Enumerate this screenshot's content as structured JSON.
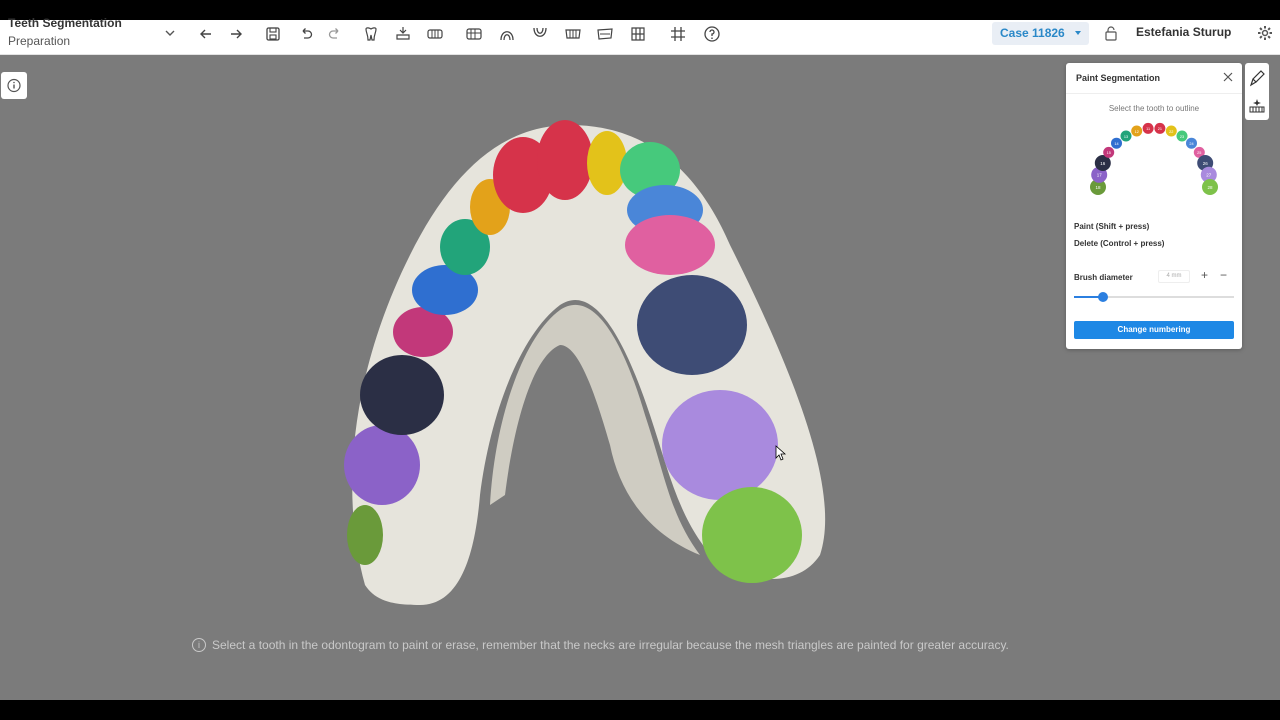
{
  "toolbar": {
    "title": "Teeth Segmentation",
    "subtitle": "Preparation",
    "icons": [
      "back-arrow-icon",
      "forward-arrow-icon",
      "save-icon",
      "undo-icon",
      "redo-icon",
      "tooth-tool-icon",
      "tooth-import-icon",
      "scan-icon",
      "jaw-icon",
      "arch-upper-icon",
      "arch-lower-icon",
      "bite-icon",
      "occlusion-icon",
      "model-icon",
      "grid-icon",
      "help-icon"
    ],
    "case_label": "Case 11826",
    "user_name": "Estefania Sturup"
  },
  "viewport": {
    "hint_text": "Select a tooth in the odontogram to paint or erase, remember that the necks are irregular because the mesh triangles are painted for greater accuracy."
  },
  "panel": {
    "title": "Paint Segmentation",
    "odontogram_label": "Select the tooth to outline",
    "paint_hint": "Paint (Shift + press)",
    "delete_hint": "Delete (Control + press)",
    "brush_label": "Brush diameter",
    "brush_value": "4 mm",
    "brush_fraction": 0.18,
    "change_button": "Change numbering",
    "teeth": [
      {
        "num": "18",
        "color": "#6a9a3a"
      },
      {
        "num": "17",
        "color": "#8b62c8"
      },
      {
        "num": "16",
        "color": "#2b2f45"
      },
      {
        "num": "15",
        "color": "#c2387a"
      },
      {
        "num": "14",
        "color": "#2f6fd0"
      },
      {
        "num": "13",
        "color": "#22a47a"
      },
      {
        "num": "12",
        "color": "#e3a21a"
      },
      {
        "num": "11",
        "color": "#d6334a"
      },
      {
        "num": "21",
        "color": "#d6334a"
      },
      {
        "num": "22",
        "color": "#e3c21a"
      },
      {
        "num": "23",
        "color": "#46c97c"
      },
      {
        "num": "24",
        "color": "#4a86d8"
      },
      {
        "num": "25",
        "color": "#e060a0"
      },
      {
        "num": "26",
        "color": "#3e4c75"
      },
      {
        "num": "27",
        "color": "#a98ade"
      },
      {
        "num": "28",
        "color": "#7ec24a"
      }
    ]
  },
  "colors": {
    "accent": "#1e88e5",
    "viewport_bg": "#7b7b7b",
    "gum": "#e6e4dc"
  }
}
